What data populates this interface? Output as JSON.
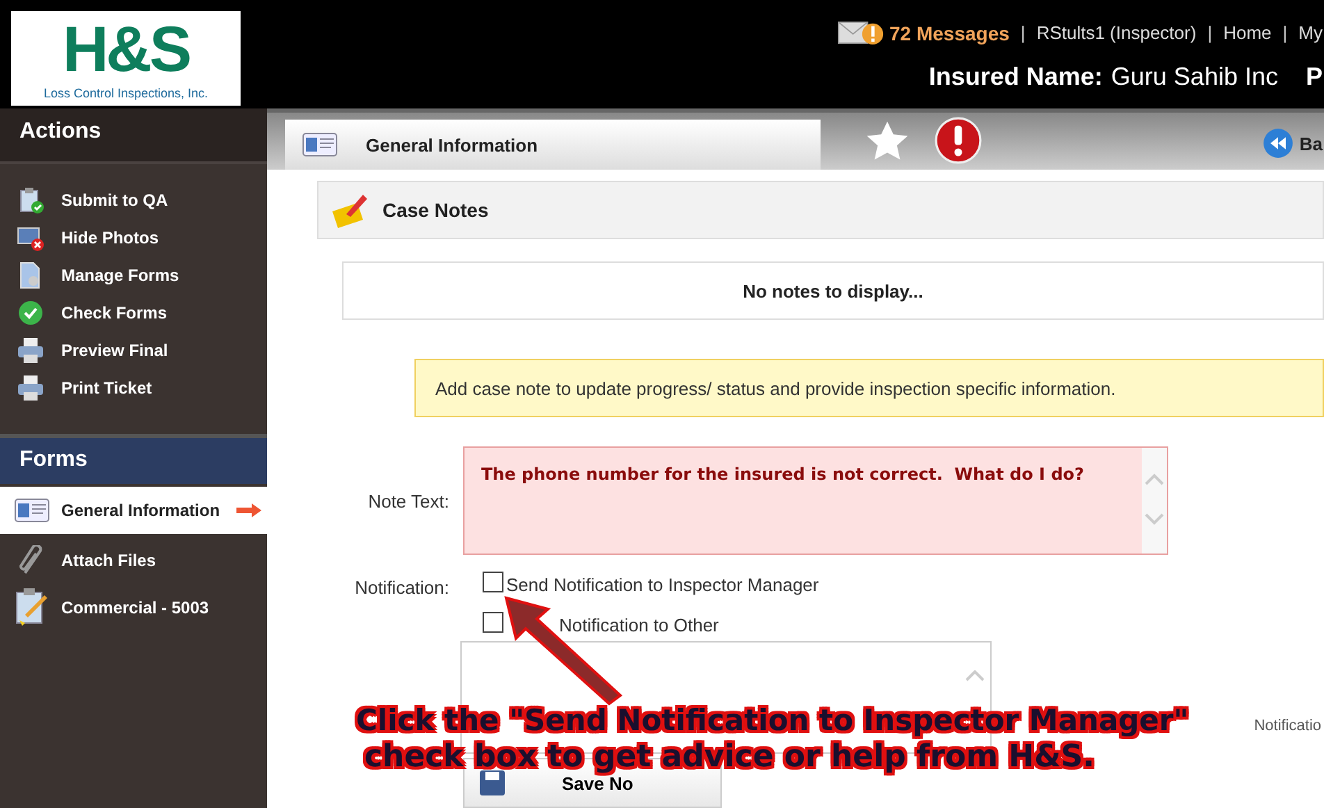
{
  "header": {
    "logo_mark": "H&S",
    "logo_sub": "Loss Control Inspections, Inc.",
    "messages": "72 Messages",
    "links": [
      "RStults1 (Inspector)",
      "Home",
      "My"
    ],
    "separator": "|",
    "insured_label": "Insured Name:",
    "insured_value": "Guru Sahib Inc",
    "insured_extra": "P"
  },
  "tab_bar": {
    "tab": "General Information",
    "back_button": "Ba"
  },
  "sidebar": {
    "actions_title": "Actions",
    "actions": [
      {
        "label": "Submit to QA",
        "kind": "submit"
      },
      {
        "label": "Hide Photos",
        "kind": "photos"
      },
      {
        "label": "Manage Forms",
        "kind": "manage"
      },
      {
        "label": "Check Forms",
        "kind": "check"
      },
      {
        "label": "Preview Final",
        "kind": "print"
      },
      {
        "label": "Print Ticket",
        "kind": "print"
      }
    ],
    "forms_title": "Forms",
    "forms": [
      {
        "label": "General Information",
        "kind": "card",
        "selected": true
      },
      {
        "label": "Attach Files",
        "kind": "clip",
        "selected": false
      },
      {
        "label": "Commercial - 5003",
        "kind": "clipboard",
        "selected": false
      }
    ]
  },
  "case_notes": {
    "title": "Case Notes",
    "empty": "No notes to display...",
    "hint": "Add case note to update progress/ status and provide inspection specific information.",
    "note_label": "Note Text:",
    "note_value": "The phone number for the insured is not correct.  What do I do?",
    "notification_label": "Notification:",
    "options": [
      {
        "label": "Send Notification to Inspector Manager",
        "checked": false
      },
      {
        "label": "Notification to Other",
        "checked": false
      }
    ],
    "email_hint": "Notificatio",
    "save_button": "Save No"
  },
  "annotation": {
    "lines": [
      "Click the \"Send Notification to Inspector Manager\"",
      "check box to get advice or help from H&S."
    ]
  }
}
